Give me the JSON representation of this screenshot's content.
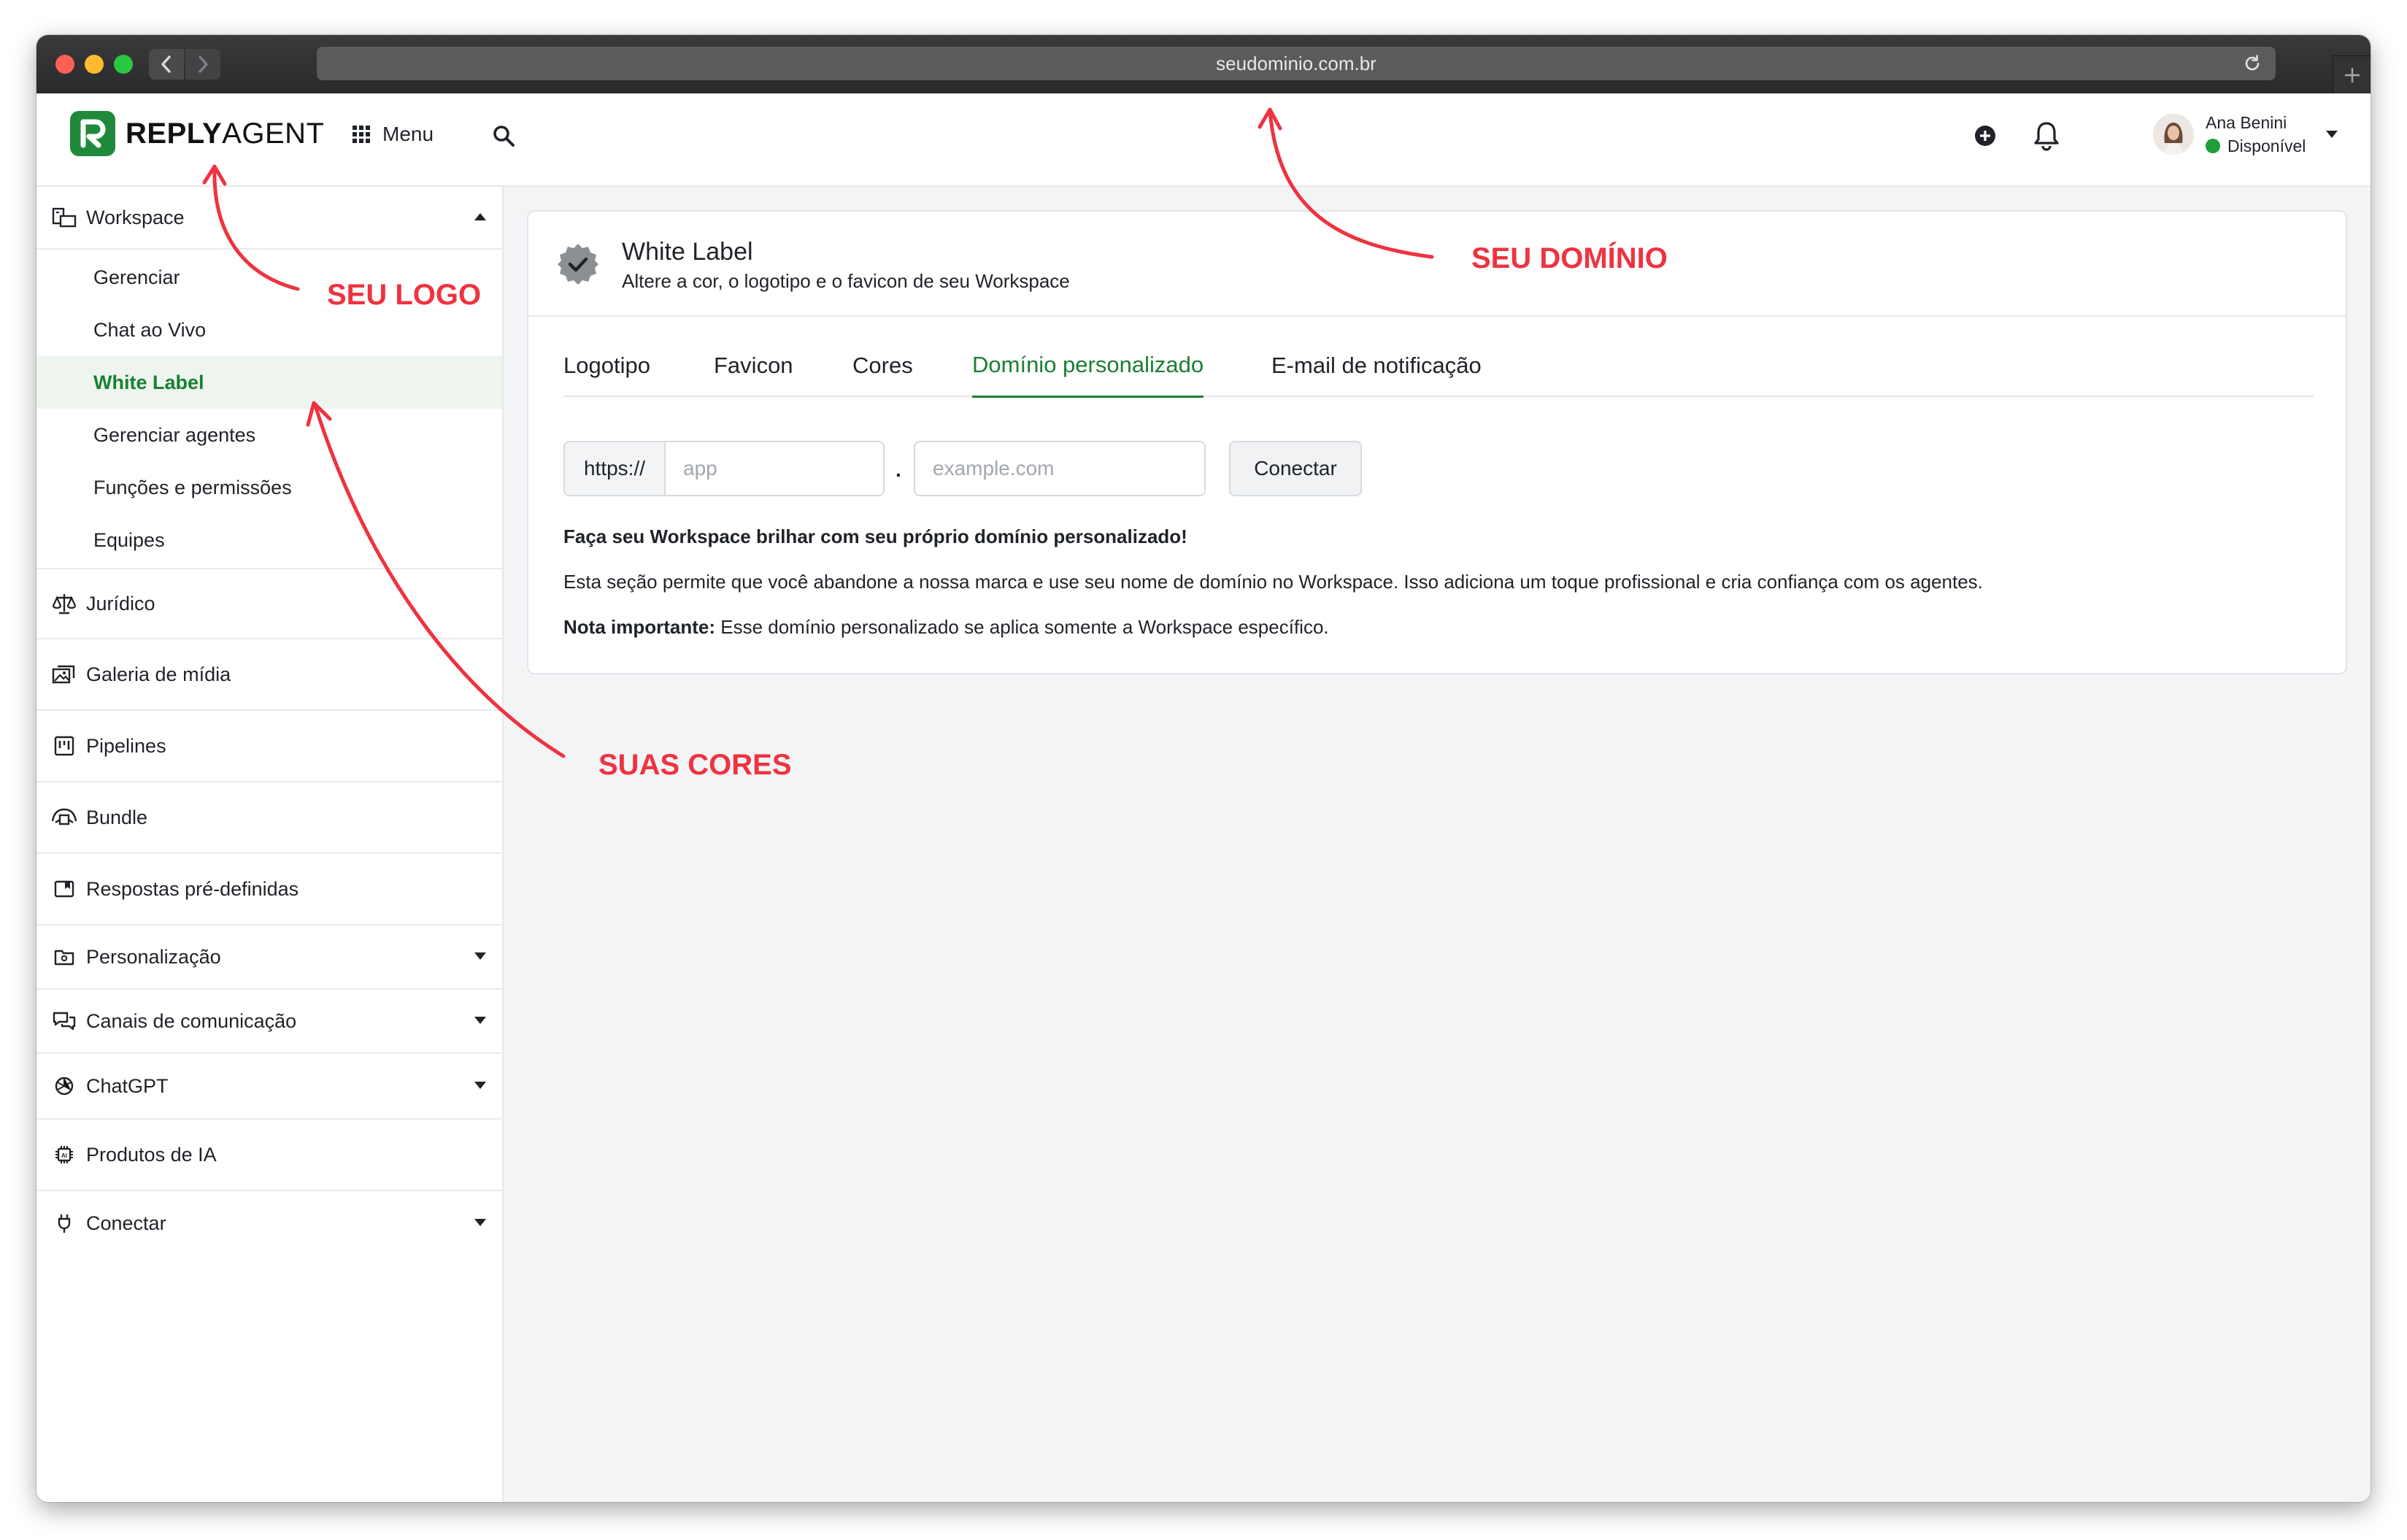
{
  "browser": {
    "url": "seudominio.com.br"
  },
  "header": {
    "logo": {
      "bold": "REPLY",
      "light": "AGENT"
    },
    "menu_label": "Menu",
    "user": {
      "name": "Ana Benini",
      "status": "Disponível",
      "status_color": "#1e9e3a"
    }
  },
  "sidebar": {
    "workspace": {
      "label": "Workspace",
      "items": [
        {
          "label": "Gerenciar"
        },
        {
          "label": "Chat ao Vivo"
        },
        {
          "label": "White Label"
        },
        {
          "label": "Gerenciar agentes"
        },
        {
          "label": "Funções e permissões"
        },
        {
          "label": "Equipes"
        }
      ]
    },
    "sections": [
      {
        "label": "Jurídico"
      },
      {
        "label": "Galeria de mídia"
      },
      {
        "label": "Pipelines"
      },
      {
        "label": "Bundle"
      },
      {
        "label": "Respostas pré-definidas"
      },
      {
        "label": "Personalização"
      },
      {
        "label": "Canais de comunicação"
      },
      {
        "label": "ChatGPT"
      },
      {
        "label": "Produtos de IA"
      },
      {
        "label": "Conectar"
      }
    ]
  },
  "card": {
    "title": "White Label",
    "subtitle": "Altere a cor, o logotipo e o favicon de seu Workspace",
    "tabs": [
      {
        "label": "Logotipo"
      },
      {
        "label": "Favicon"
      },
      {
        "label": "Cores"
      },
      {
        "label": "Domínio personalizado"
      },
      {
        "label": "E-mail de notificação"
      }
    ],
    "form": {
      "prefix": "https://",
      "subdomain_placeholder": "app",
      "separator": ".",
      "domain_placeholder": "example.com",
      "connect_label": "Conectar"
    },
    "heading": "Faça seu Workspace brilhar com seu próprio domínio personalizado!",
    "description": "Esta seção permite que você abandone a nossa marca e use seu nome de domínio no Workspace. Isso adiciona um toque profissional e cria confiança com os agentes.",
    "note_label": "Nota importante:",
    "note_text": " Esse domínio personalizado se aplica somente a Workspace específico."
  },
  "annotations": {
    "logo": "SEU LOGO",
    "domain": "SEU DOMÍNIO",
    "colors": "SUAS CORES",
    "color": "#ee3340"
  },
  "colors": {
    "accent": "#1a7f32",
    "brand": "#1f8a3a"
  }
}
